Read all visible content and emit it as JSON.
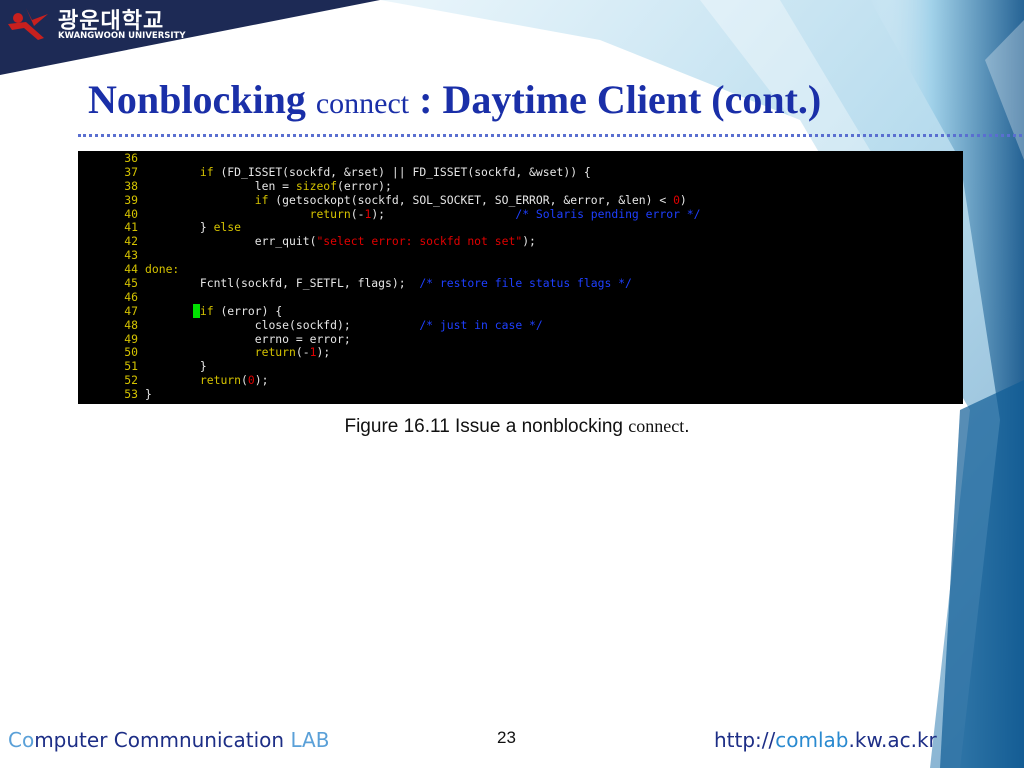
{
  "logo": {
    "korean": "광운대학교",
    "english": "KWANGWOON UNIVERSITY"
  },
  "title": {
    "part1": "Nonblocking",
    "part2": "connect",
    "part3": ": Daytime Client (cont.)"
  },
  "code_lines": [
    {
      "num": "36",
      "tokens": []
    },
    {
      "num": "37",
      "tokens": [
        {
          "t": "        "
        },
        {
          "t": "if",
          "c": "kw"
        },
        {
          "t": " (FD_ISSET(sockfd, &rset) || FD_ISSET(sockfd, &wset)) {"
        }
      ]
    },
    {
      "num": "38",
      "tokens": [
        {
          "t": "                len = "
        },
        {
          "t": "sizeof",
          "c": "kw"
        },
        {
          "t": "(error);"
        }
      ]
    },
    {
      "num": "39",
      "tokens": [
        {
          "t": "                "
        },
        {
          "t": "if",
          "c": "kw"
        },
        {
          "t": " (getsockopt(sockfd, SOL_SOCKET, SO_ERROR, &error, &len) < "
        },
        {
          "t": "0",
          "c": "num"
        },
        {
          "t": ")"
        }
      ]
    },
    {
      "num": "40",
      "tokens": [
        {
          "t": "                        "
        },
        {
          "t": "return",
          "c": "kw"
        },
        {
          "t": "(-"
        },
        {
          "t": "1",
          "c": "num"
        },
        {
          "t": ");                   "
        },
        {
          "t": "/* Solaris pending error */",
          "c": "cm"
        }
      ]
    },
    {
      "num": "41",
      "tokens": [
        {
          "t": "        } "
        },
        {
          "t": "else",
          "c": "kw"
        }
      ]
    },
    {
      "num": "42",
      "tokens": [
        {
          "t": "                err_quit("
        },
        {
          "t": "\"select error: sockfd not set\"",
          "c": "str"
        },
        {
          "t": ");"
        }
      ]
    },
    {
      "num": "43",
      "tokens": []
    },
    {
      "num": "44",
      "tokens": [
        {
          "t": "done:",
          "c": "lbl"
        }
      ]
    },
    {
      "num": "45",
      "tokens": [
        {
          "t": "        Fcntl(sockfd, F_SETFL, flags);  "
        },
        {
          "t": "/* restore file status flags */",
          "c": "cm"
        }
      ]
    },
    {
      "num": "46",
      "tokens": []
    },
    {
      "num": "47",
      "tokens": [
        {
          "t": "       "
        },
        {
          "t": " ",
          "c": "cursor"
        },
        {
          "t": "if",
          "c": "kw"
        },
        {
          "t": " (error) {"
        }
      ]
    },
    {
      "num": "48",
      "tokens": [
        {
          "t": "                close(sockfd);          "
        },
        {
          "t": "/* just in case */",
          "c": "cm"
        }
      ]
    },
    {
      "num": "49",
      "tokens": [
        {
          "t": "                errno = error;"
        }
      ]
    },
    {
      "num": "50",
      "tokens": [
        {
          "t": "                "
        },
        {
          "t": "return",
          "c": "kw"
        },
        {
          "t": "(-"
        },
        {
          "t": "1",
          "c": "num"
        },
        {
          "t": ");"
        }
      ]
    },
    {
      "num": "51",
      "tokens": [
        {
          "t": "        }"
        }
      ]
    },
    {
      "num": "52",
      "tokens": [
        {
          "t": "        "
        },
        {
          "t": "return",
          "c": "kw"
        },
        {
          "t": "("
        },
        {
          "t": "0",
          "c": "num"
        },
        {
          "t": ");"
        }
      ]
    },
    {
      "num": "53",
      "tokens": [
        {
          "t": "}"
        }
      ]
    }
  ],
  "caption": {
    "prefix": "Figure 16.11 Issue a nonblocking ",
    "mono": "connect",
    "suffix": "."
  },
  "footer": {
    "left_co": "Co",
    "left_rest": "mputer Commnunication ",
    "left_lab": "LAB",
    "page_number": "23",
    "url_prefix": "http://",
    "url_accent": "comlab",
    "url_suffix": ".kw.ac.kr"
  },
  "colors": {
    "title": "#1a2fa8",
    "code_bg": "#000000",
    "keyword": "#d4c200",
    "number": "#e00000",
    "comment": "#1e3fff"
  }
}
